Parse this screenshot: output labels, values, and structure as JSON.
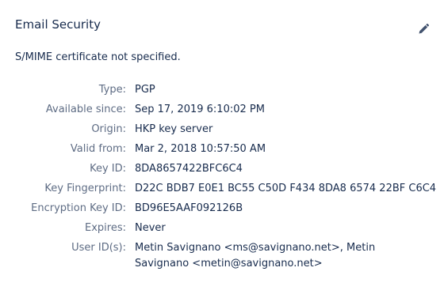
{
  "section": {
    "title": "Email Security",
    "edit_icon": "pencil-icon",
    "smime_status": "S/MIME certificate not specified."
  },
  "key": {
    "type_label": "Type:",
    "type_value": "PGP",
    "available_label": "Available since:",
    "available_value": "Sep 17, 2019 6:10:02 PM",
    "origin_label": "Origin:",
    "origin_value": "HKP key server",
    "valid_label": "Valid from:",
    "valid_value": "Mar 2, 2018 10:57:50 AM",
    "keyid_label": "Key ID:",
    "keyid_value": "8DA8657422BFC6C4",
    "fingerprint_label": "Key Fingerprint:",
    "fingerprint_value": "D22C BDB7 E0E1 BC55 C50D F434 8DA8 6574 22BF C6C4",
    "enc_label": "Encryption Key ID:",
    "enc_value": "BD96E5AAF092126B",
    "expires_label": "Expires:",
    "expires_value": "Never",
    "userids_label": "User ID(s):",
    "userids_value": "Metin Savignano <ms@savignano.net>, Metin Savignano <metin@savignano.net>"
  }
}
